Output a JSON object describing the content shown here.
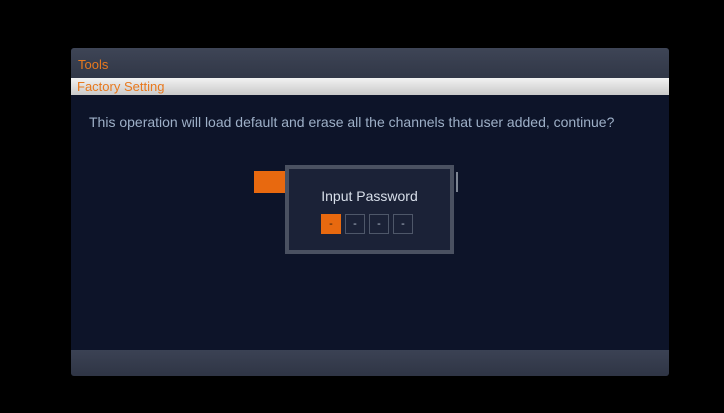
{
  "header": {
    "title": "Tools"
  },
  "subheader": {
    "title": "Factory Setting"
  },
  "message": "This operation will load default and erase all the channels that user added, continue?",
  "dialog": {
    "title": "Input Password",
    "digits": [
      "-",
      "-",
      "-",
      "-"
    ],
    "active_index": 0
  },
  "colors": {
    "accent": "#e8690f",
    "title_text": "#e8791e",
    "panel_bg": "#0d1429"
  }
}
